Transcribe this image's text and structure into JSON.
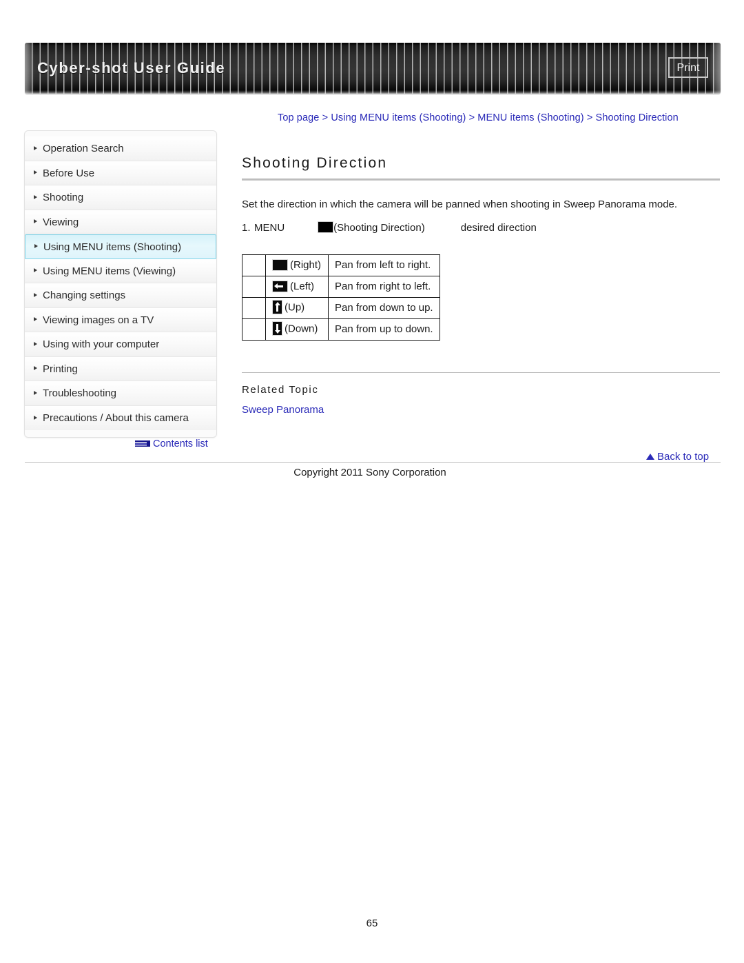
{
  "header": {
    "title": "Cyber-shot User Guide",
    "print_label": "Print"
  },
  "breadcrumb": {
    "items": [
      "Top page",
      "Using MENU items (Shooting)",
      "MENU items (Shooting)",
      "Shooting Direction"
    ],
    "separator": ">"
  },
  "sidebar": {
    "items": [
      {
        "label": "Operation Search",
        "active": false
      },
      {
        "label": "Before Use",
        "active": false
      },
      {
        "label": "Shooting",
        "active": false
      },
      {
        "label": "Viewing",
        "active": false
      },
      {
        "label": "Using MENU items (Shooting)",
        "active": true
      },
      {
        "label": "Using MENU items (Viewing)",
        "active": false
      },
      {
        "label": "Changing settings",
        "active": false
      },
      {
        "label": "Viewing images on a TV",
        "active": false
      },
      {
        "label": "Using with your computer",
        "active": false
      },
      {
        "label": "Printing",
        "active": false
      },
      {
        "label": "Troubleshooting",
        "active": false
      },
      {
        "label": "Precautions / About this camera",
        "active": false
      }
    ],
    "contents_list_label": "Contents list"
  },
  "main": {
    "title": "Shooting Direction",
    "intro": "Set the direction in which the camera will be panned when shooting in Sweep Panorama mode.",
    "step": {
      "number": "1.",
      "menu": "MENU",
      "target": "(Shooting Direction)",
      "action": "desired direction"
    },
    "table": {
      "rows": [
        {
          "icon": "arrow-right-icon",
          "option": "(Right)",
          "description": "Pan from left to right."
        },
        {
          "icon": "arrow-left-icon",
          "option": "(Left)",
          "description": "Pan from right to left."
        },
        {
          "icon": "arrow-up-icon",
          "option": "(Up)",
          "description": "Pan from down to up."
        },
        {
          "icon": "arrow-down-icon",
          "option": "(Down)",
          "description": "Pan from up to down."
        }
      ]
    },
    "related": {
      "heading": "Related Topic",
      "links": [
        "Sweep Panorama"
      ]
    }
  },
  "footer": {
    "back_to_top": "Back to top",
    "copyright": "Copyright 2011 Sony Corporation",
    "page_number": "65"
  },
  "colors": {
    "link": "#2a2ab8",
    "active_nav_bg": "#dff4fb",
    "active_nav_border": "#7fd4e8",
    "banner_dark": "#2e2e2e"
  }
}
